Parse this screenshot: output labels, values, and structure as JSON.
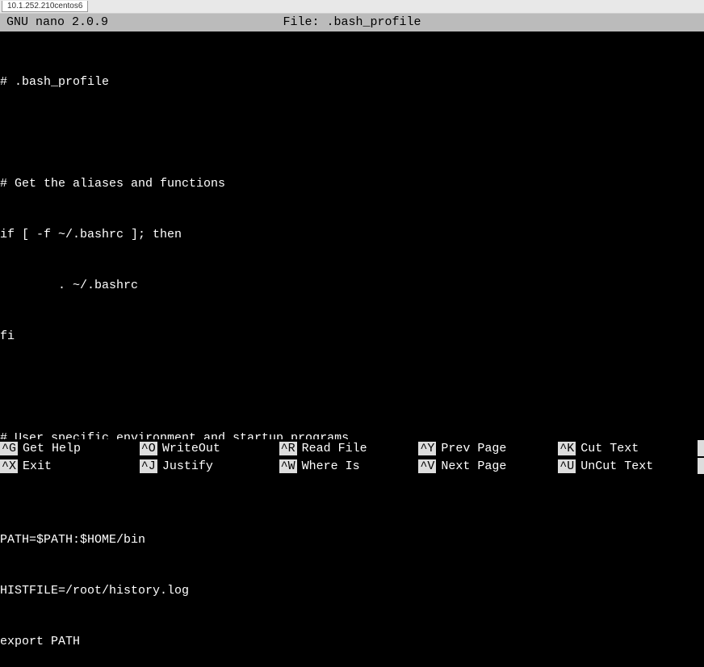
{
  "window": {
    "tab_label": "10.1.252.210centos6"
  },
  "titlebar": {
    "app_version": "GNU nano 2.0.9",
    "file_label": "File: .bash_profile"
  },
  "editor": {
    "lines": [
      "# .bash_profile",
      "",
      "# Get the aliases and functions",
      "if [ -f ~/.bashrc ]; then",
      "        . ~/.bashrc",
      "fi",
      "",
      "# User specific environment and startup programs",
      "",
      "PATH=$PATH:$HOME/bin",
      "HISTFILE=/root/history.log",
      "export PATH"
    ]
  },
  "help": {
    "row1": [
      {
        "key": "^G",
        "label": "Get Help"
      },
      {
        "key": "^O",
        "label": "WriteOut"
      },
      {
        "key": "^R",
        "label": "Read File"
      },
      {
        "key": "^Y",
        "label": "Prev Page"
      },
      {
        "key": "^K",
        "label": "Cut Text"
      }
    ],
    "row2": [
      {
        "key": "^X",
        "label": "Exit"
      },
      {
        "key": "^J",
        "label": "Justify"
      },
      {
        "key": "^W",
        "label": "Where Is"
      },
      {
        "key": "^V",
        "label": "Next Page"
      },
      {
        "key": "^U",
        "label": "UnCut Text"
      }
    ]
  }
}
